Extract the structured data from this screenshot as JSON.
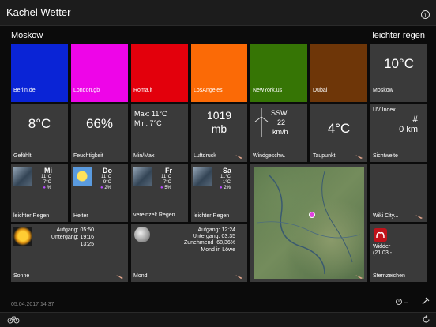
{
  "app": {
    "title": "Kachel Wetter"
  },
  "header": {
    "city": "Moskow",
    "condition": "leichter regen"
  },
  "color_tiles": [
    {
      "label": "Berlin,de",
      "color": "#0a24d6"
    },
    {
      "label": "London,gb",
      "color": "#ee05e8"
    },
    {
      "label": "Roma,it",
      "color": "#e3000c"
    },
    {
      "label": "LosAngeles",
      "color": "#fb6a06"
    },
    {
      "label": "NewYork,us",
      "color": "#367505"
    },
    {
      "label": "Dubai",
      "color": "#6e3608"
    }
  ],
  "current": {
    "temp": "10°C",
    "label": "Moskow"
  },
  "row2": {
    "feels": {
      "value": "8°C",
      "label": "Gefühlt"
    },
    "humidity": {
      "value": "66%",
      "label": "Feuchtigkeit"
    },
    "minmax": {
      "max": "Max: 11°C",
      "min": "Min: 7°C",
      "label": "Min/Max"
    },
    "pressure": {
      "value": "1019",
      "unit": "mb",
      "label": "Luftdruck"
    },
    "wind": {
      "dir": "SSW",
      "speed": "22",
      "unit": "km/h",
      "label": "Windgeschw."
    },
    "dew": {
      "value": "4°C",
      "label": "Taupunkt"
    },
    "uv": {
      "title": "UV Index",
      "value": "#",
      "vis": "0 km",
      "label": "Sichtweite"
    }
  },
  "forecast": [
    {
      "day": "Mi",
      "high": "11°C",
      "low": "7°C",
      "rain": "%",
      "label": "leichter Regen",
      "icon": "rain-icon"
    },
    {
      "day": "Do",
      "high": "11°C",
      "low": "9°C",
      "rain": "2%",
      "label": "Heiter",
      "icon": "sun-icon"
    },
    {
      "day": "Fr",
      "high": "11°C",
      "low": "7°C",
      "rain": "5%",
      "label": "vereinzelt Regen",
      "icon": "rain-icon"
    },
    {
      "day": "Sa",
      "high": "11°C",
      "low": "1°C",
      "rain": "2%",
      "label": "leichter Regen",
      "icon": "rain-icon"
    }
  ],
  "wiki": {
    "label": "Wiki City..."
  },
  "sun": {
    "rise": "Aufgang: 05:50",
    "set": "Untergang: 19:16",
    "length": "13:25",
    "label": "Sonne"
  },
  "moon": {
    "rise": "Aufgang: 12:24",
    "set": "Untergang: 03:35",
    "phase": "Zunehmend  68,36%",
    "sign": "Mond in Löwe",
    "label": "Mond"
  },
  "zodiac": {
    "name": "Widder",
    "date": "(21.03.-",
    "label": "Sternzeichen"
  },
  "footer": {
    "date": "05.04.2017 14:37"
  },
  "icons": {
    "info": "i"
  }
}
